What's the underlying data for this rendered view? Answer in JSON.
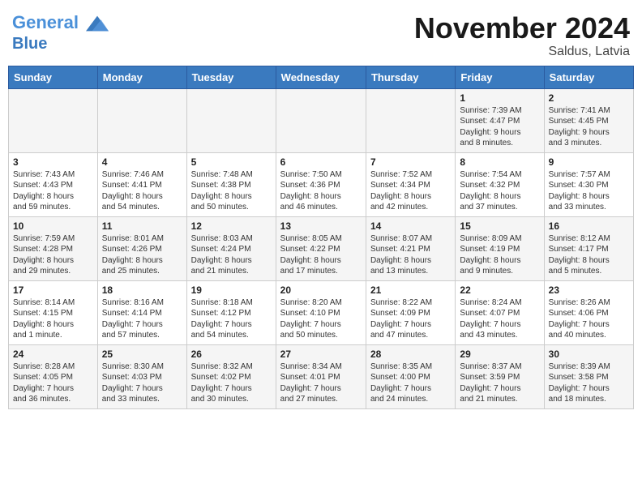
{
  "header": {
    "logo_line1": "General",
    "logo_line2": "Blue",
    "month": "November 2024",
    "location": "Saldus, Latvia"
  },
  "weekdays": [
    "Sunday",
    "Monday",
    "Tuesday",
    "Wednesday",
    "Thursday",
    "Friday",
    "Saturday"
  ],
  "weeks": [
    [
      {
        "day": "",
        "info": ""
      },
      {
        "day": "",
        "info": ""
      },
      {
        "day": "",
        "info": ""
      },
      {
        "day": "",
        "info": ""
      },
      {
        "day": "",
        "info": ""
      },
      {
        "day": "1",
        "info": "Sunrise: 7:39 AM\nSunset: 4:47 PM\nDaylight: 9 hours\nand 8 minutes."
      },
      {
        "day": "2",
        "info": "Sunrise: 7:41 AM\nSunset: 4:45 PM\nDaylight: 9 hours\nand 3 minutes."
      }
    ],
    [
      {
        "day": "3",
        "info": "Sunrise: 7:43 AM\nSunset: 4:43 PM\nDaylight: 8 hours\nand 59 minutes."
      },
      {
        "day": "4",
        "info": "Sunrise: 7:46 AM\nSunset: 4:41 PM\nDaylight: 8 hours\nand 54 minutes."
      },
      {
        "day": "5",
        "info": "Sunrise: 7:48 AM\nSunset: 4:38 PM\nDaylight: 8 hours\nand 50 minutes."
      },
      {
        "day": "6",
        "info": "Sunrise: 7:50 AM\nSunset: 4:36 PM\nDaylight: 8 hours\nand 46 minutes."
      },
      {
        "day": "7",
        "info": "Sunrise: 7:52 AM\nSunset: 4:34 PM\nDaylight: 8 hours\nand 42 minutes."
      },
      {
        "day": "8",
        "info": "Sunrise: 7:54 AM\nSunset: 4:32 PM\nDaylight: 8 hours\nand 37 minutes."
      },
      {
        "day": "9",
        "info": "Sunrise: 7:57 AM\nSunset: 4:30 PM\nDaylight: 8 hours\nand 33 minutes."
      }
    ],
    [
      {
        "day": "10",
        "info": "Sunrise: 7:59 AM\nSunset: 4:28 PM\nDaylight: 8 hours\nand 29 minutes."
      },
      {
        "day": "11",
        "info": "Sunrise: 8:01 AM\nSunset: 4:26 PM\nDaylight: 8 hours\nand 25 minutes."
      },
      {
        "day": "12",
        "info": "Sunrise: 8:03 AM\nSunset: 4:24 PM\nDaylight: 8 hours\nand 21 minutes."
      },
      {
        "day": "13",
        "info": "Sunrise: 8:05 AM\nSunset: 4:22 PM\nDaylight: 8 hours\nand 17 minutes."
      },
      {
        "day": "14",
        "info": "Sunrise: 8:07 AM\nSunset: 4:21 PM\nDaylight: 8 hours\nand 13 minutes."
      },
      {
        "day": "15",
        "info": "Sunrise: 8:09 AM\nSunset: 4:19 PM\nDaylight: 8 hours\nand 9 minutes."
      },
      {
        "day": "16",
        "info": "Sunrise: 8:12 AM\nSunset: 4:17 PM\nDaylight: 8 hours\nand 5 minutes."
      }
    ],
    [
      {
        "day": "17",
        "info": "Sunrise: 8:14 AM\nSunset: 4:15 PM\nDaylight: 8 hours\nand 1 minute."
      },
      {
        "day": "18",
        "info": "Sunrise: 8:16 AM\nSunset: 4:14 PM\nDaylight: 7 hours\nand 57 minutes."
      },
      {
        "day": "19",
        "info": "Sunrise: 8:18 AM\nSunset: 4:12 PM\nDaylight: 7 hours\nand 54 minutes."
      },
      {
        "day": "20",
        "info": "Sunrise: 8:20 AM\nSunset: 4:10 PM\nDaylight: 7 hours\nand 50 minutes."
      },
      {
        "day": "21",
        "info": "Sunrise: 8:22 AM\nSunset: 4:09 PM\nDaylight: 7 hours\nand 47 minutes."
      },
      {
        "day": "22",
        "info": "Sunrise: 8:24 AM\nSunset: 4:07 PM\nDaylight: 7 hours\nand 43 minutes."
      },
      {
        "day": "23",
        "info": "Sunrise: 8:26 AM\nSunset: 4:06 PM\nDaylight: 7 hours\nand 40 minutes."
      }
    ],
    [
      {
        "day": "24",
        "info": "Sunrise: 8:28 AM\nSunset: 4:05 PM\nDaylight: 7 hours\nand 36 minutes."
      },
      {
        "day": "25",
        "info": "Sunrise: 8:30 AM\nSunset: 4:03 PM\nDaylight: 7 hours\nand 33 minutes."
      },
      {
        "day": "26",
        "info": "Sunrise: 8:32 AM\nSunset: 4:02 PM\nDaylight: 7 hours\nand 30 minutes."
      },
      {
        "day": "27",
        "info": "Sunrise: 8:34 AM\nSunset: 4:01 PM\nDaylight: 7 hours\nand 27 minutes."
      },
      {
        "day": "28",
        "info": "Sunrise: 8:35 AM\nSunset: 4:00 PM\nDaylight: 7 hours\nand 24 minutes."
      },
      {
        "day": "29",
        "info": "Sunrise: 8:37 AM\nSunset: 3:59 PM\nDaylight: 7 hours\nand 21 minutes."
      },
      {
        "day": "30",
        "info": "Sunrise: 8:39 AM\nSunset: 3:58 PM\nDaylight: 7 hours\nand 18 minutes."
      }
    ]
  ]
}
